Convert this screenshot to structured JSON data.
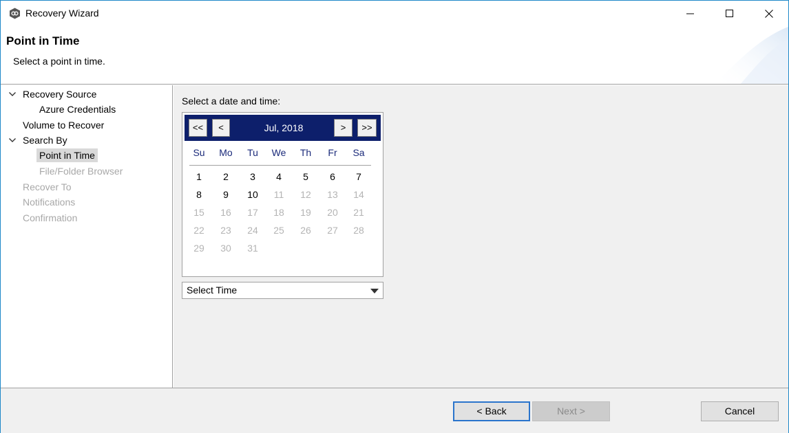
{
  "window": {
    "title": "Recovery Wizard",
    "icon": "peer-logo-icon",
    "controls": [
      "minimize-icon",
      "maximize-icon",
      "close-icon"
    ]
  },
  "header": {
    "title": "Point in Time",
    "subtitle": "Select a point in time."
  },
  "nav": {
    "items": [
      {
        "label": "Recovery Source",
        "expanded": true,
        "state": "normal"
      },
      {
        "label": "Azure Credentials",
        "state": "normal"
      },
      {
        "label": "Volume to Recover",
        "state": "normal"
      },
      {
        "label": "Search By",
        "expanded": true,
        "state": "normal"
      },
      {
        "label": "Point in Time",
        "state": "selected"
      },
      {
        "label": "File/Folder Browser",
        "state": "disabled"
      },
      {
        "label": "Recover To",
        "state": "disabled"
      },
      {
        "label": "Notifications",
        "state": "disabled"
      },
      {
        "label": "Confirmation",
        "state": "disabled"
      }
    ]
  },
  "main": {
    "prompt": "Select a date and time:",
    "calendar": {
      "prev_year": "<<",
      "prev_month": "<",
      "month_label": "Jul, 2018",
      "next_month": ">",
      "next_year": ">>",
      "weekdays": [
        "Su",
        "Mo",
        "Tu",
        "We",
        "Th",
        "Fr",
        "Sa"
      ],
      "weeks": [
        [
          "1",
          "2",
          "3",
          "4",
          "5",
          "6",
          "7"
        ],
        [
          "8",
          "9",
          "10",
          "11",
          "12",
          "13",
          "14"
        ],
        [
          "15",
          "16",
          "17",
          "18",
          "19",
          "20",
          "21"
        ],
        [
          "22",
          "23",
          "24",
          "25",
          "26",
          "27",
          "28"
        ],
        [
          "29",
          "30",
          "31",
          "",
          "",
          "",
          ""
        ]
      ],
      "last_enabled_day": 10,
      "header_color": "#0d1f6b"
    },
    "time_select": {
      "value": "Select Time"
    }
  },
  "footer": {
    "back": "< Back",
    "next": "Next >",
    "cancel": "Cancel"
  }
}
